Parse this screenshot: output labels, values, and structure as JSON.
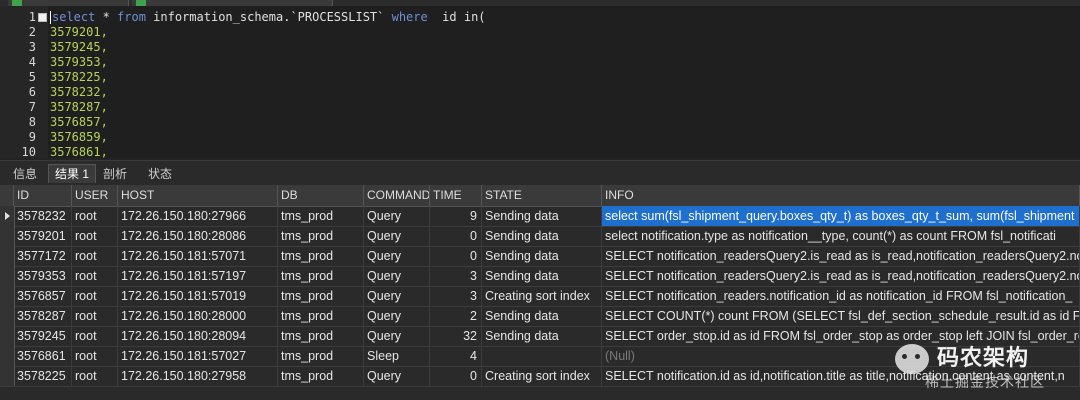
{
  "editor": {
    "line1": {
      "n": "1",
      "t1": "select",
      "t2": " * ",
      "t3": "from",
      "t4": " information_schema.`PROCESSLIST` ",
      "t5": "where",
      "t6": "  id ",
      "t7": "in("
    },
    "numbered_lines": [
      {
        "n": "2",
        "code": "3579201,"
      },
      {
        "n": "3",
        "code": "3579245,"
      },
      {
        "n": "4",
        "code": "3579353,"
      },
      {
        "n": "5",
        "code": "3578225,"
      },
      {
        "n": "6",
        "code": "3578232,"
      },
      {
        "n": "7",
        "code": "3578287,"
      },
      {
        "n": "8",
        "code": "3576857,"
      },
      {
        "n": "9",
        "code": "3576859,"
      },
      {
        "n": "10",
        "code": "3576861,"
      }
    ]
  },
  "result_tabs": [
    "信息",
    "结果 1",
    "剖析",
    "状态"
  ],
  "grid": {
    "columns": [
      "ID",
      "USER",
      "HOST",
      "DB",
      "COMMAND",
      "TIME",
      "STATE",
      "INFO"
    ],
    "rows": [
      [
        "3578232",
        "root",
        "172.26.150.180:27966",
        "tms_prod",
        "Query",
        "9",
        "Sending data",
        "select sum(fsl_shipment_query.boxes_qty_t) as boxes_qty_t_sum, sum(fsl_shipment"
      ],
      [
        "3579201",
        "root",
        "172.26.150.180:28086",
        "tms_prod",
        "Query",
        "0",
        "Sending data",
        "select notification.type as notification__type, count(*) as  count  FROM fsl_notificati"
      ],
      [
        "3577172",
        "root",
        "172.26.150.181:57071",
        "tms_prod",
        "Query",
        "0",
        "Sending data",
        "SELECT notification_readersQuery2.is_read as is_read,notification_readersQuery2.no"
      ],
      [
        "3579353",
        "root",
        "172.26.150.181:57197",
        "tms_prod",
        "Query",
        "3",
        "Sending data",
        "SELECT notification_readersQuery2.is_read as is_read,notification_readersQuery2.no"
      ],
      [
        "3576857",
        "root",
        "172.26.150.181:57019",
        "tms_prod",
        "Query",
        "3",
        "Creating sort index",
        "SELECT notification_readers.notification_id as notification_id FROM fsl_notification_"
      ],
      [
        "3578287",
        "root",
        "172.26.150.180:28000",
        "tms_prod",
        "Query",
        "2",
        "Sending data",
        "SELECT COUNT(*) count FROM (SELECT fsl_def_section_schedule_result.id as id FRO"
      ],
      [
        "3579245",
        "root",
        "172.26.150.180:28094",
        "tms_prod",
        "Query",
        "32",
        "Sending data",
        "SELECT order_stop.id as id FROM fsl_order_stop as order_stop left JOIN fsl_order_re"
      ],
      [
        "3576861",
        "root",
        "172.26.150.181:57027",
        "tms_prod",
        "Sleep",
        "4",
        "",
        "(Null)"
      ],
      [
        "3578225",
        "root",
        "172.26.150.180:27958",
        "tms_prod",
        "Query",
        "0",
        "Creating sort index",
        "SELECT notification.id as id,notification.title as title,notification.content as content,n"
      ]
    ]
  },
  "watermark": {
    "title": "码农架构",
    "subtitle": "稀土掘金技术社区"
  }
}
